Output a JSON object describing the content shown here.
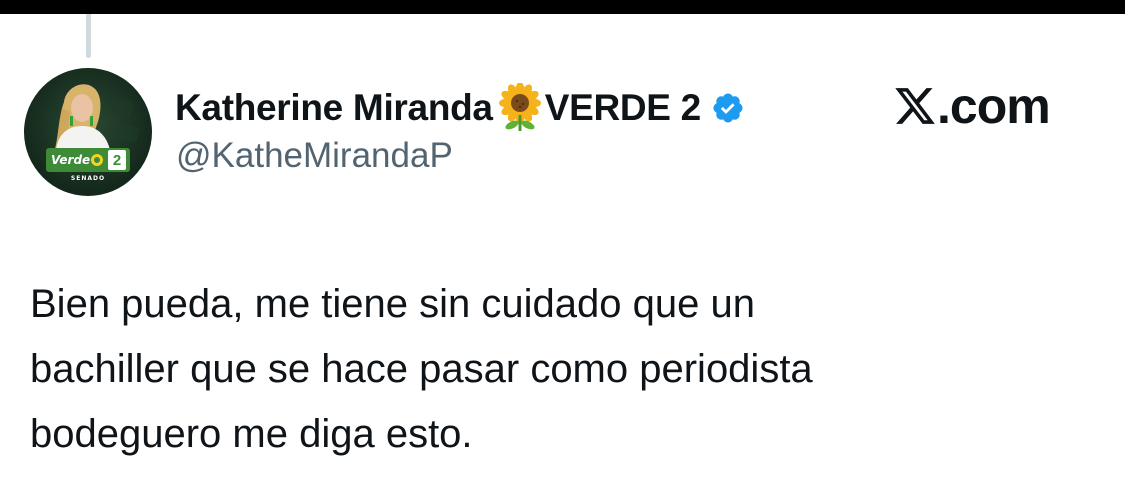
{
  "author": {
    "display_name_part1": "Katherine Miranda",
    "display_name_emoji": "sunflower-emoji",
    "display_name_part2": "VERDE 2",
    "handle": "@KatheMirandaP",
    "verified_badge": "verified-badge-icon",
    "verified_color": "#1d9bf0"
  },
  "avatar": {
    "party_label": "Verde",
    "list_number": "2",
    "sub_label": "SENADO",
    "brand_green": "#3d8b37",
    "ring_yellow": "#f5d21f"
  },
  "watermark": {
    "logo_icon": "x-logo-icon",
    "text": ".com"
  },
  "tweet": {
    "lines": [
      "Bien pueda, me tiene sin cuidado que un",
      "bachiller que se hace pasar como periodista",
      "bodeguero me diga esto."
    ]
  },
  "colors": {
    "text_primary": "#0f1419",
    "text_secondary": "#536471",
    "thread_line": "#cfd9de"
  }
}
